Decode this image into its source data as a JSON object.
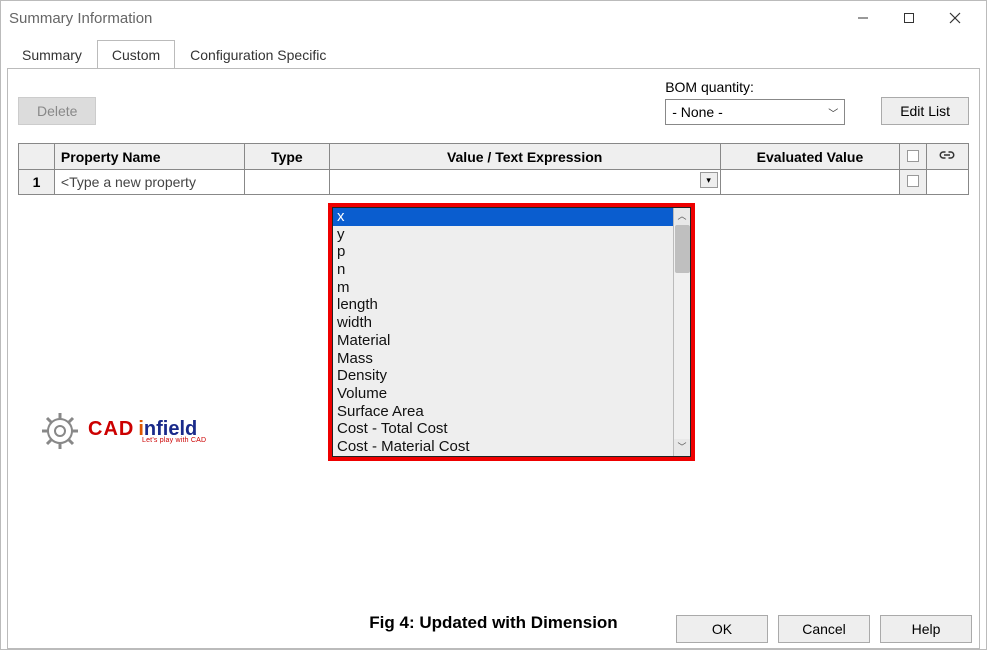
{
  "window": {
    "title": "Summary Information"
  },
  "tabs": {
    "summary": "Summary",
    "custom": "Custom",
    "config": "Configuration Specific"
  },
  "toolbar": {
    "delete": "Delete",
    "bom_label": "BOM quantity:",
    "bom_value": "- None -",
    "edit_list": "Edit List"
  },
  "grid": {
    "headers": {
      "property_name": "Property Name",
      "type": "Type",
      "value": "Value / Text Expression",
      "evaluated": "Evaluated Value"
    },
    "rows": [
      {
        "num": "1",
        "property": "<Type a new property",
        "type": "",
        "value": "",
        "evaluated": ""
      }
    ]
  },
  "dropdown": {
    "items": [
      "x",
      "y",
      "p",
      "n",
      "m",
      "length",
      "width",
      "Material",
      "Mass",
      "Density",
      "Volume",
      "Surface Area",
      "Cost - Total Cost",
      "Cost - Material Cost"
    ],
    "selected_index": 0
  },
  "logo": {
    "cad": "CAD",
    "infield": "nfield",
    "tagline": "Let's play with CAD"
  },
  "caption": "Fig 4: Updated with Dimension",
  "footer": {
    "ok": "OK",
    "cancel": "Cancel",
    "help": "Help"
  }
}
